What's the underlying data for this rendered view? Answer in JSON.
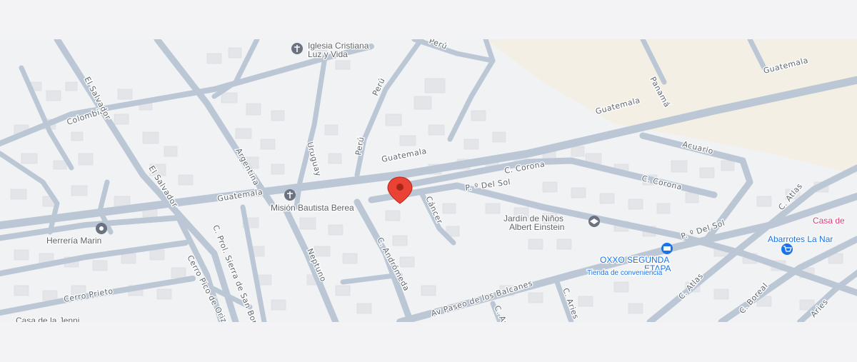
{
  "map": {
    "streets": {
      "guatemala": "Guatemala",
      "colombia": "Colombia",
      "el_salvador": "El Salvador",
      "argentina": "Argentina",
      "uruguay": "Uruguay",
      "peru": "Perú",
      "c_corona": "C. Corona",
      "p_del_sol": "P. º Del Sol",
      "acuario": "Acuario",
      "cancer": "Cáncer",
      "c_andromeda": "C. Andrómeda",
      "neptuno": "Neptuno",
      "c_prol_sierra": "C. Prol. Sierra de San Borja",
      "cerro_pico": "Cerro Pico de Orizaba",
      "cerro_prieto": "Cerro Prieto",
      "av_paseo": "Av Paseo de los Balcanes",
      "c_atlas": "C. Atlas",
      "c_boreal": "C. Boreal",
      "aries": "Aries",
      "c_aries": "C. Aries",
      "panama": "Panamá",
      "peru_top": "Perú",
      "c_aries_small": "C. Ar"
    },
    "pois": {
      "iglesia_line1": "Iglesia Cristiana",
      "iglesia_line2": "Luz y Vida",
      "mision": "Misión Bautista Berea",
      "herreria": "Herrería Marin",
      "jardin_line1": "Jardín de Niños",
      "jardin_line2": "Albert Einstein",
      "oxxo_line1": "OXXO SEGUNDA",
      "oxxo_line2": "ETAPA",
      "oxxo_sub": "Tienda de conveniencia",
      "abarrotes": "Abarrotes La Nar",
      "casa_de": "Casa de",
      "casa_jenni": "Casa de la Jenni"
    },
    "colors": {
      "road": "#bcc7d6",
      "block": "#f1f2f4",
      "building": "#e4e6ea",
      "land": "#f3efe4",
      "pin": "#ea4335",
      "poi_grey": "#6b7280",
      "poi_blue": "#1a73e8"
    },
    "icons": {
      "location_pin": "red-location-pin-icon",
      "church": "church-cross-icon",
      "school": "school-icon",
      "store": "shopping-cart-icon",
      "generic_place": "place-marker-icon"
    }
  }
}
